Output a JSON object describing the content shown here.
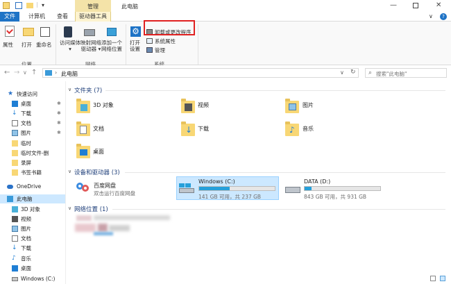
{
  "titlebar": {
    "context_tab": "管理",
    "title": "此电脑"
  },
  "tabs": [
    "文件",
    "计算机",
    "查看",
    "驱动器工具"
  ],
  "ribbon": {
    "location_buttons": [
      "属性",
      "打开",
      "重命名"
    ],
    "location_group": "位置",
    "network_buttons": [
      {
        "line1": "访问媒体",
        "line2": "▾"
      },
      {
        "line1": "映射网络",
        "line2": "驱动器 ▾"
      },
      {
        "line1": "添加一个",
        "line2": "网络位置"
      }
    ],
    "network_group": "网络",
    "open_settings": {
      "line1": "打开",
      "line2": "设置"
    },
    "system_items": [
      "卸载或更改程序",
      "系统属性",
      "管理"
    ],
    "system_group": "系统"
  },
  "nav": {
    "address": "此电脑",
    "search_placeholder": "搜索\"此电脑\""
  },
  "sidebar": {
    "items": [
      {
        "label": "快速访问",
        "icon": "star-icon"
      },
      {
        "label": "桌面",
        "icon": "desktop-icon",
        "pinned": true
      },
      {
        "label": "下载",
        "icon": "download-icon",
        "pinned": true
      },
      {
        "label": "文档",
        "icon": "document-icon",
        "pinned": true
      },
      {
        "label": "图片",
        "icon": "picture-icon",
        "pinned": true
      },
      {
        "label": "临时",
        "icon": "folder-icon"
      },
      {
        "label": "临时文件-删",
        "icon": "folder-icon"
      },
      {
        "label": "录屏",
        "icon": "folder-icon"
      },
      {
        "label": "书签书籍",
        "icon": "folder-icon"
      },
      {
        "label": "OneDrive",
        "icon": "cloud-icon"
      },
      {
        "label": "此电脑",
        "icon": "pc-icon",
        "selected": true
      },
      {
        "label": "3D 对象",
        "icon": "3d-icon"
      },
      {
        "label": "视频",
        "icon": "video-icon"
      },
      {
        "label": "图片",
        "icon": "picture-icon"
      },
      {
        "label": "文档",
        "icon": "document-icon"
      },
      {
        "label": "下载",
        "icon": "download-icon"
      },
      {
        "label": "音乐",
        "icon": "music-icon"
      },
      {
        "label": "桌面",
        "icon": "desktop-icon"
      },
      {
        "label": "Windows (C:)",
        "icon": "drive-icon"
      }
    ]
  },
  "sections": {
    "folders_title": "文件夹 (7)",
    "devices_title": "设备和驱动器 (3)",
    "network_title": "网络位置 (1)"
  },
  "folders": [
    "3D 对象",
    "视频",
    "图片",
    "文档",
    "下载",
    "音乐",
    "桌面"
  ],
  "devices": {
    "baidu": {
      "name": "百度网盘",
      "sub": "双击运行百度网盘"
    },
    "c_drive": {
      "name": "Windows (C:)",
      "free": "141 GB 可用，共 237 GB",
      "used_fraction": 0.405
    },
    "d_drive": {
      "name": "DATA (D:)",
      "free": "843 GB 可用，共 931 GB",
      "used_fraction": 0.095
    }
  },
  "colors": {
    "accent": "#1e73c6",
    "context_tab": "#f4e3a8",
    "selection": "#cce8ff",
    "bar_fill": "#26a0da",
    "highlight": "#e02020"
  }
}
